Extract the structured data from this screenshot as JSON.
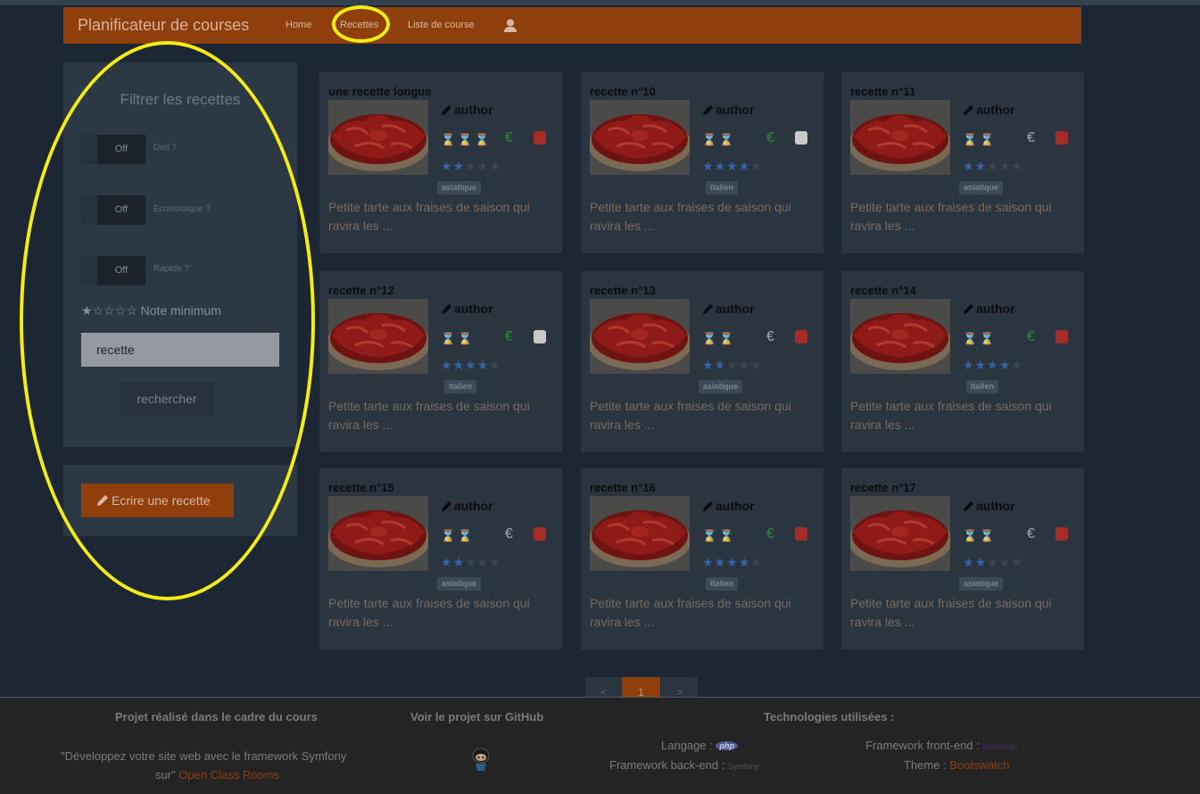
{
  "navbar": {
    "brand": "Planificateur de courses",
    "links": [
      "Home",
      "Recettes",
      "Liste de course"
    ],
    "user_icon": "user-icon"
  },
  "sidebar": {
    "title": "Filtrer les recettes",
    "toggles": [
      {
        "state": "Off",
        "label": "Diet ?"
      },
      {
        "state": "Off",
        "label": "Economique ?"
      },
      {
        "state": "Off",
        "label": "Rapide ?"
      }
    ],
    "rating_stars": "★☆☆☆☆",
    "rating_label": "Note minimum",
    "search_value": "recette",
    "search_button": "rechercher",
    "write_button": "Ecrire une recette"
  },
  "recipes": [
    {
      "title": "une recette longue",
      "author": "author",
      "time": "⌛⌛⌛",
      "euro_color": "#2e8a39",
      "dish_color": "#a62c27",
      "rating": 2,
      "tag": "asiatique",
      "description": "Petite tarte aux fraises de saison qui ravira les ..."
    },
    {
      "title": "recette n°10",
      "author": "author",
      "time": "⌛⌛",
      "euro_color": "#2e8a39",
      "dish_color": "#c9c9c9",
      "rating": 4,
      "tag": "italien",
      "description": "Petite tarte aux fraises de saison qui ravira les ..."
    },
    {
      "title": "recette n°11",
      "author": "author",
      "time": "⌛⌛",
      "euro_color": "#a8a8a8",
      "dish_color": "#a62c27",
      "rating": 2,
      "tag": "asiatique",
      "description": "Petite tarte aux fraises de saison qui ravira les ..."
    },
    {
      "title": "recette n°12",
      "author": "author",
      "time": "⌛⌛",
      "euro_color": "#2e8a39",
      "dish_color": "#c9c9c9",
      "rating": 4,
      "tag": "italien",
      "description": "Petite tarte aux fraises de saison qui ravira les ..."
    },
    {
      "title": "recette n°13",
      "author": "author",
      "time": "⌛⌛",
      "euro_color": "#a8a8a8",
      "dish_color": "#a62c27",
      "rating": 2,
      "tag": "asiatique",
      "description": "Petite tarte aux fraises de saison qui ravira les ..."
    },
    {
      "title": "recette n°14",
      "author": "author",
      "time": "⌛⌛",
      "euro_color": "#2e8a39",
      "dish_color": "#a62c27",
      "rating": 4,
      "tag": "italien",
      "description": "Petite tarte aux fraises de saison qui ravira les ..."
    },
    {
      "title": "recette n°15",
      "author": "author",
      "time": "⌛⌛",
      "euro_color": "#a8a8a8",
      "dish_color": "#a62c27",
      "rating": 2,
      "tag": "asiatique",
      "description": "Petite tarte aux fraises de saison qui ravira les ..."
    },
    {
      "title": "recette n°16",
      "author": "author",
      "time": "⌛⌛",
      "euro_color": "#2e8a39",
      "dish_color": "#a62c27",
      "rating": 4,
      "tag": "italien",
      "description": "Petite tarte aux fraises de saison qui ravira les ..."
    },
    {
      "title": "recette n°17",
      "author": "author",
      "time": "⌛⌛",
      "euro_color": "#a8a8a8",
      "dish_color": "#a62c27",
      "rating": 2,
      "tag": "asiatique",
      "description": "Petite tarte aux fraises de saison qui ravira les ..."
    }
  ],
  "pagination": {
    "prev": "<",
    "current": "1",
    "next": ">"
  },
  "footer": {
    "col1_heading": "Projet réalisé dans le cadre du cours",
    "col1_text": "\"Développez votre site web avec le framework Symfony",
    "col1_text2": "sur\"",
    "col1_link": "Open Class Rooms",
    "col2_heading": "Voir le projet sur GitHub",
    "col3_heading": "Technologies utilisées :",
    "language_label": "Langage :",
    "language_logo": "php",
    "backend_label": "Framework back-end :",
    "backend_logo": "Symfony",
    "frontend_label": "Framework front-end :",
    "frontend_logo": "Bootstrap",
    "theme_label": "Theme :",
    "theme_link": "Bootswatch"
  },
  "colors": {
    "accent": "#8e3f0c",
    "highlight": "#f4ec15",
    "star": "#3763a8"
  }
}
